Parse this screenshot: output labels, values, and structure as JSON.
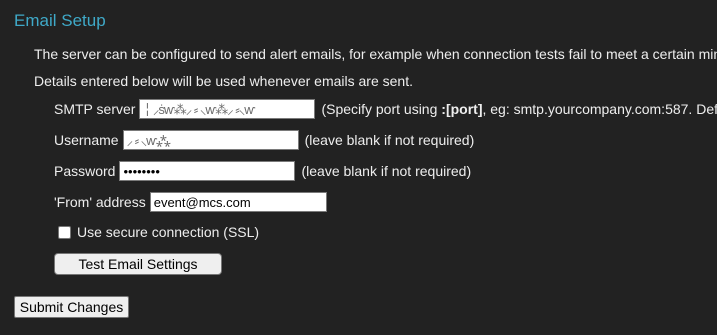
{
  "section": {
    "title": "Email Setup",
    "description_line1": "The server can be configured to send alert emails, for example when connection tests fail to meet a certain min",
    "description_line2": "Details entered below will be used whenever emails are sent."
  },
  "form": {
    "smtp_server": {
      "label": "SMTP server",
      "value": "╎ ⸝ṡⱳ⁂⸝ ⸗ ⸜ⱳ⁂⸝ ⸗⸜ⱳ",
      "hint_prefix": "(Specify port using ",
      "hint_bold": ":[port]",
      "hint_suffix": ", eg: smtp.yourcompany.com:587. Def"
    },
    "username": {
      "label": "Username",
      "value": "⸝ ⸗ ⸜ⱳ⁂",
      "hint": "(leave blank if not required)"
    },
    "password": {
      "label": "Password",
      "value": "••••••••",
      "hint": "(leave blank if not required)"
    },
    "from_address": {
      "label": "'From' address",
      "value": "event@mcs.com"
    },
    "secure_connection": {
      "label": "Use secure connection (SSL)",
      "checked": false
    },
    "test_button_label": "Test Email Settings"
  },
  "submit_button_label": "Submit Changes"
}
